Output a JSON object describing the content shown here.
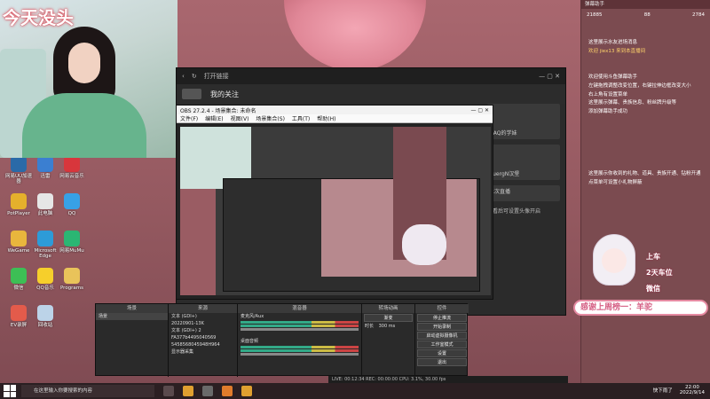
{
  "webcam": {
    "overlay_title": "今天没头"
  },
  "desktop_icons": [
    {
      "name": "app-icon-1",
      "label": "网易UU加速器",
      "color": "#2a6aa8"
    },
    {
      "name": "app-icon-2",
      "label": "迅雷",
      "color": "#3b7fd1"
    },
    {
      "name": "app-icon-3",
      "label": "网易云音乐",
      "color": "#d8363c"
    },
    {
      "name": "app-icon-4",
      "label": "PotPlayer",
      "color": "#e5b02c"
    },
    {
      "name": "app-icon-5",
      "label": "此电脑",
      "color": "#e6e6e6"
    },
    {
      "name": "app-icon-6",
      "label": "QQ",
      "color": "#37a1e6"
    },
    {
      "name": "app-icon-7",
      "label": "WeGame",
      "color": "#e9b63d"
    },
    {
      "name": "app-icon-8",
      "label": "Microsoft Edge",
      "color": "#2d9bd8"
    },
    {
      "name": "app-icon-9",
      "label": "网易MuMu",
      "color": "#2bb673"
    },
    {
      "name": "app-icon-10",
      "label": "微信",
      "color": "#3dbf55"
    },
    {
      "name": "app-icon-11",
      "label": "QQ音乐",
      "color": "#f6cf2b"
    },
    {
      "name": "app-icon-12",
      "label": "Programs",
      "color": "#e9c35a"
    },
    {
      "name": "app-icon-13",
      "label": "EV录屏",
      "color": "#e35b4b"
    },
    {
      "name": "app-icon-14",
      "label": "回收站",
      "color": "#bcd3e8"
    }
  ],
  "browser": {
    "toolbar_text": "打开链接",
    "header_title": "我的关注",
    "right_cards": [
      {
        "title": "QAQ的学妹"
      },
      {
        "title": "AuergN汉堡"
      }
    ],
    "live_badge": "上次直播",
    "footer": "观看后可设置头像开启"
  },
  "obs": {
    "window_title": "OBS 27.2.4 - 场景集合: 未命名",
    "menu": [
      "文件(F)",
      "编辑(E)",
      "视图(V)",
      "场景集合(S)",
      "工具(T)",
      "帮助(H)"
    ]
  },
  "docks": {
    "scenes": {
      "header": "场景",
      "items": [
        "场景"
      ]
    },
    "sources": {
      "header": "来源",
      "items": [
        "文本 (GDI+)",
        "20220901-13K",
        "文本 (GDI+) 2",
        "FA377b4495040569",
        "5458568045948H964",
        "显示器采集"
      ]
    },
    "mixer": {
      "header": "混音器",
      "tracks": [
        "麦克风/Aux",
        "桌面音频"
      ]
    },
    "transitions": {
      "header": "转场动画",
      "mode": "渐变",
      "duration_label": "时长",
      "duration": "300 ms"
    },
    "controls": {
      "header": "控件",
      "buttons": [
        "停止推流",
        "开始录制",
        "启动虚拟摄像机",
        "工作室模式",
        "设置",
        "退出"
      ]
    }
  },
  "obs_status": {
    "text": "LIVE: 00:12:34  REC: 00:00:00  CPU: 3.1%, 30.00 fps"
  },
  "chat": {
    "header": "弹幕助手",
    "stats": [
      "21885",
      "88",
      "2784"
    ],
    "lines": [
      "这里展示水友进场消息",
      "欢迎 jiex13 来到本直播间",
      "欢迎使用斗鱼弹幕助手",
      "左键拖拽调整改变位置，右键拉伸边框改变大小",
      "右上角有设置菜单",
      "这里展示弹幕、贵族信息、粉丝牌升级等",
      "添加弹幕助手成功",
      "这里展示你收到的礼物、道具、贵族开通、钻粉开通",
      "点菜单可设置小礼物屏蔽"
    ]
  },
  "overlay": {
    "items": [
      "上车",
      "2天车位",
      "微信"
    ],
    "banner": "感谢上周榜一：羊驼"
  },
  "taskbar": {
    "search_placeholder": "在这里输入你要搜索的内容",
    "weather": "快下雨了",
    "time": "22:00",
    "date": "2022/9/14"
  }
}
